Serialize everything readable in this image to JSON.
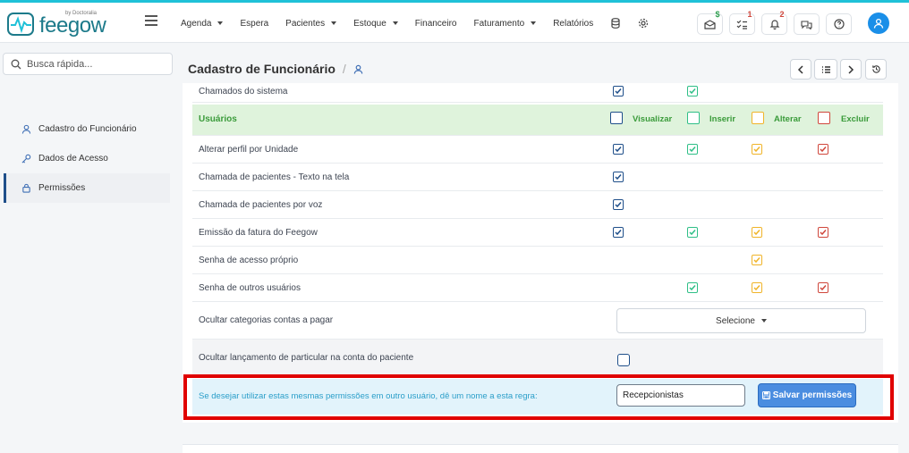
{
  "brand": {
    "name": "feegow",
    "by": "by Doctoralia",
    "accent": "#20c1d8"
  },
  "nav": {
    "items": [
      {
        "label": "Agenda",
        "caret": true
      },
      {
        "label": "Espera",
        "caret": false
      },
      {
        "label": "Pacientes",
        "caret": true
      },
      {
        "label": "Estoque",
        "caret": true
      },
      {
        "label": "Financeiro",
        "caret": false
      },
      {
        "label": "Faturamento",
        "caret": true
      },
      {
        "label": "Relatórios",
        "caret": false
      }
    ]
  },
  "header_icons": {
    "messages_badge": "$",
    "tasks_badge": "1",
    "notifications_badge": "2"
  },
  "search": {
    "placeholder": "Busca rápida..."
  },
  "sidebar": {
    "items": [
      {
        "label": "Cadastro do Funcionário",
        "icon": "user-icon",
        "active": false
      },
      {
        "label": "Dados de Acesso",
        "icon": "key-icon",
        "active": false
      },
      {
        "label": "Permissões",
        "icon": "lock-icon",
        "active": true
      }
    ]
  },
  "page": {
    "title": "Cadastro de Funcionário",
    "sep": "/"
  },
  "permissions": {
    "prev_row_label": "Chamados do sistema",
    "section": {
      "title": "Usuários",
      "columns": [
        "Visualizar",
        "Inserir",
        "Alterar",
        "Excluir"
      ],
      "colors": [
        "#1f4f8a",
        "#2fbf87",
        "#f0b429",
        "#d0473c"
      ]
    },
    "rows": [
      {
        "label": "Alterar perfil por Unidade",
        "checks": [
          true,
          true,
          true,
          true
        ]
      },
      {
        "label": "Chamada de pacientes - Texto na tela",
        "checks": [
          true,
          null,
          null,
          null
        ]
      },
      {
        "label": "Chamada de pacientes por voz",
        "checks": [
          true,
          null,
          null,
          null
        ]
      },
      {
        "label": "Emissão da fatura do Feegow",
        "checks": [
          true,
          true,
          true,
          true
        ]
      },
      {
        "label": "Senha de acesso próprio",
        "checks": [
          null,
          null,
          true,
          null
        ]
      },
      {
        "label": "Senha de outros usuários",
        "checks": [
          null,
          true,
          true,
          true
        ]
      }
    ],
    "hide_categories": {
      "label": "Ocultar categorias contas a pagar",
      "select": "Selecione"
    },
    "hide_private": {
      "label": "Ocultar lançamento de particular na conta do paciente",
      "checked": false
    },
    "rule": {
      "text": "Se desejar utilizar estas mesmas permissões em outro usuário, dê um nome a esta regra:",
      "input_value": "Recepcionistas",
      "save_label": "Salvar permissões"
    }
  }
}
